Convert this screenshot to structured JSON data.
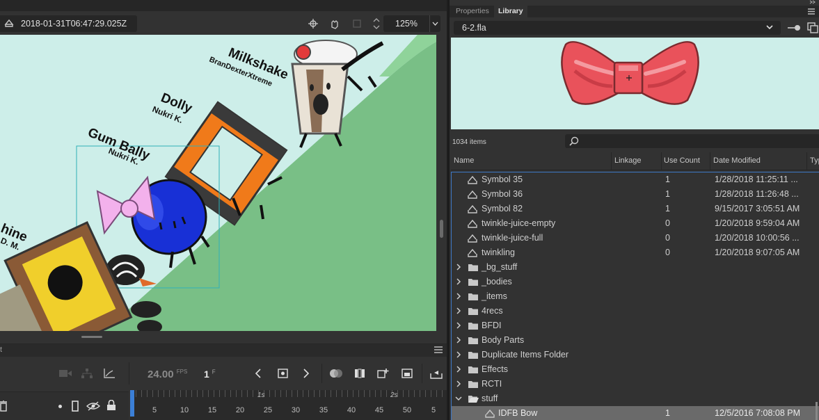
{
  "stage": {
    "timestamp": "2018-01-31T06:47:29.025Z",
    "zoom": "125%",
    "characters": [
      {
        "name": "Milkshake",
        "author": "BranDexterXtreme"
      },
      {
        "name": "Dolly",
        "author": "Nukri K."
      },
      {
        "name": "Gum Bally",
        "author": "Nukri K."
      },
      {
        "name": "hine",
        "author": "D. M."
      }
    ]
  },
  "timeline": {
    "panel_stub": "t",
    "fps": "24.00",
    "fps_unit": "FPS",
    "frame": "1",
    "frame_unit": "F",
    "ticks": [
      "5",
      "10",
      "15",
      "20",
      "25",
      "30",
      "35",
      "40",
      "45",
      "50",
      "5"
    ],
    "seconds": [
      "1s",
      "2s"
    ]
  },
  "library": {
    "tabs": [
      "Properties",
      "Library"
    ],
    "active_tab": "Library",
    "document": "6-2.fla",
    "items_count": "1034 items",
    "columns": [
      "Name",
      "Linkage",
      "Use Count",
      "Date Modified",
      "Typ"
    ],
    "rows": [
      {
        "type": "symbol",
        "name": "Symbol 35",
        "use_count": "1",
        "date": "1/28/2018 11:25:11 ..."
      },
      {
        "type": "symbol",
        "name": "Symbol 36",
        "use_count": "1",
        "date": "1/28/2018 11:26:48 ..."
      },
      {
        "type": "symbol",
        "name": "Symbol 82",
        "use_count": "1",
        "date": "9/15/2017 3:05:51 AM"
      },
      {
        "type": "symbol",
        "name": "twinkle-juice-empty",
        "use_count": "0",
        "date": "1/20/2018 9:59:04 AM"
      },
      {
        "type": "symbol",
        "name": "twinkle-juice-full",
        "use_count": "0",
        "date": "1/20/2018 10:00:56 ..."
      },
      {
        "type": "symbol",
        "name": "twinkling",
        "use_count": "0",
        "date": "1/20/2018 9:07:05 AM"
      },
      {
        "type": "folder",
        "name": "_bg_stuff",
        "use_count": "",
        "date": ""
      },
      {
        "type": "folder",
        "name": "_bodies",
        "use_count": "",
        "date": ""
      },
      {
        "type": "folder",
        "name": "_items",
        "use_count": "",
        "date": ""
      },
      {
        "type": "folder",
        "name": "4recs",
        "use_count": "",
        "date": ""
      },
      {
        "type": "folder",
        "name": "BFDI",
        "use_count": "",
        "date": ""
      },
      {
        "type": "folder",
        "name": "Body Parts",
        "use_count": "",
        "date": ""
      },
      {
        "type": "folder",
        "name": "Duplicate Items Folder",
        "use_count": "",
        "date": ""
      },
      {
        "type": "folder",
        "name": "Effects",
        "use_count": "",
        "date": ""
      },
      {
        "type": "folder",
        "name": "RCTI",
        "use_count": "",
        "date": ""
      },
      {
        "type": "folder-open",
        "name": "stuff",
        "use_count": "",
        "date": ""
      },
      {
        "type": "symbol-sel",
        "name": "IDFB Bow",
        "use_count": "1",
        "date": "12/5/2016 7:08:08 PM"
      }
    ]
  },
  "colors": {
    "stage_bg": "#cdeee9",
    "hill": "#79bf86",
    "selection": "#3d77c5",
    "panel": "#323232"
  }
}
